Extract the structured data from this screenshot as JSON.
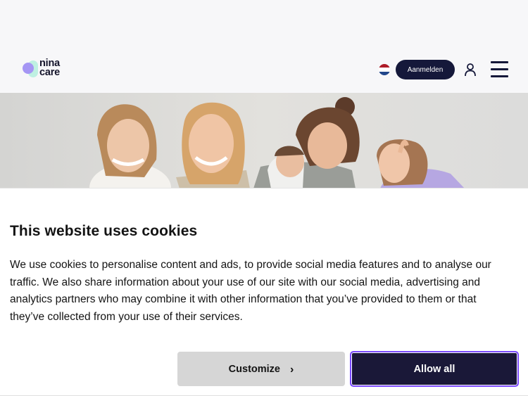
{
  "header": {
    "logo_line1": "nina",
    "logo_line2": "care",
    "language_flag": "dutch-flag",
    "login_label": "Aanmelden",
    "user_icon": "user-icon",
    "menu_icon": "hamburger-menu-icon"
  },
  "hero": {
    "image": "photo-of-four-smiling-women-and-a-baby"
  },
  "cookie_banner": {
    "title": "This website uses cookies",
    "body": "We use cookies to personalise content and ads, to provide social media features and to analyse our traffic. We also share information about your use of our site with our social media, advertising and analytics partners who may combine it with other information that you’ve provided to them or that they’ve collected from your use of their services.",
    "customize_label": "Customize",
    "customize_icon": "chevron-right-icon",
    "allow_label": "Allow all"
  },
  "colors": {
    "brand_navy": "#15183a",
    "focus_purple": "#7b4bff",
    "logo_purple": "#a596f4",
    "logo_mint": "#bff0e2"
  }
}
